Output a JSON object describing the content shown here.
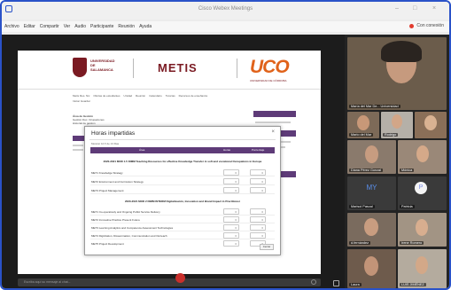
{
  "window": {
    "title": "Cisco Webex Meetings",
    "controls": [
      "–",
      "□",
      "×"
    ]
  },
  "menu": {
    "items": [
      "Archivo",
      "Editar",
      "Compartir",
      "Ver",
      "Audio",
      "Participante",
      "Reunión",
      "Ayuda"
    ],
    "connection": "Con conexión"
  },
  "shared_page": {
    "logo_usal": "UNIVERSIDAD\nDE\nSALAMANCA",
    "brand": "METIS",
    "logo_uco": "UCO",
    "logo_uco_sub": "UNIVERSIDAD DE CÓRDOBA",
    "nav": [
      "Metis Res. Nix",
      "Ofertas de estudiantes",
      "Unidad",
      "Reunión",
      "Calendario",
      "Tutorías",
      "Recursos de enseñanza"
    ],
    "subnav": "Iniciar Guardar",
    "left_lines": [
      "Área de Gestión",
      "Gestión Dec. Ocupaciones",
      "Historial de gestión"
    ],
    "left_header": "Área de Gestión"
  },
  "modal": {
    "title": "Horas impartidas",
    "close": "×",
    "subtitle": "Mostrar 10 ▾ de 13 filas",
    "columns": [
      "Área",
      "Horas",
      "Porcentaje"
    ],
    "sections": [
      {
        "title": "2020-2021 MOD 1.5 DIMM Teaching Resources for effective Knowledge Transfer in soft and vocational Occupations in Europe",
        "rows": [
          {
            "label": "MET1 Knowledge Strategy",
            "hours": "0",
            "percent": "0"
          },
          {
            "label": "MET2 Environment and Curriculum Strategy",
            "hours": "0",
            "percent": "0"
          },
          {
            "label": "MET3 Project Management",
            "hours": "0",
            "percent": "0"
          }
        ]
      },
      {
        "title": "2020-2021 MOD 2 DIMM INTERM Digitalización, Innovation and Brand Impact in Practitioner",
        "rows": [
          {
            "label": "MET1 Co-operatively and Ongoing Public Service Delivery",
            "hours": "0",
            "percent": "0"
          },
          {
            "label": "MET2 Innovative Practice Present Future",
            "hours": "0",
            "percent": "0"
          },
          {
            "label": "MET3 Learning Analytics and Competence Assessment Technologies",
            "hours": "0",
            "percent": "0"
          },
          {
            "label": "MET4 Digitization, Dissemination, Communication and Outreach",
            "hours": "0",
            "percent": "0"
          },
          {
            "label": "MET5 Project Development",
            "hours": "0",
            "percent": "0"
          }
        ]
      }
    ],
    "button": "Cerrar"
  },
  "chat": {
    "placeholder": "Escriba aquí su mensaje al chat..."
  },
  "participants": [
    {
      "name": "María del Mar De... Universidad",
      "kind": "video",
      "bg": "#6b5c4b"
    },
    {
      "name": "Mario del Mar",
      "kind": "video",
      "bg": "#7d6a58"
    },
    {
      "name": "Rodrigo",
      "kind": "video",
      "bg": "#b5b0a8"
    },
    {
      "name": "Diana Pérez Gonzal",
      "kind": "video",
      "bg": "#8a7a6c"
    },
    {
      "name": "Mónica",
      "kind": "video",
      "bg": "#9a8878"
    },
    {
      "name": "Marisol Pascal",
      "kind": "initials",
      "initials": "MY",
      "bg": "#3a3a3a"
    },
    {
      "name": "Patricia",
      "kind": "avatar",
      "initials": "P",
      "bg": "#3a3a3a"
    },
    {
      "name": "d.fernández",
      "kind": "video",
      "bg": "#7a6b5e"
    },
    {
      "name": "Irene Romero",
      "kind": "video",
      "bg": "#a29484"
    },
    {
      "name": "Laura",
      "kind": "video",
      "bg": "#6e5b4c"
    },
    {
      "name": "LUIS JIMÉNEZ",
      "kind": "video",
      "bg": "#b4ab9e"
    }
  ],
  "colors": {
    "accent": "#5e3b78",
    "usal": "#7a1a22",
    "uco": "#e0621a",
    "frame": "#2a52c8"
  }
}
